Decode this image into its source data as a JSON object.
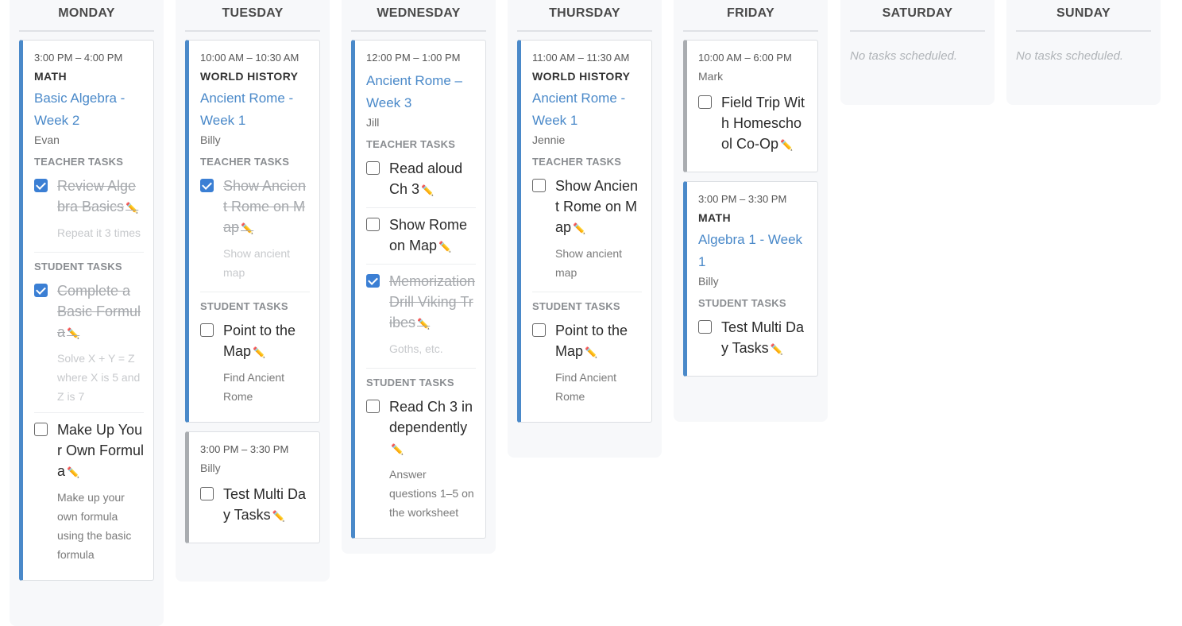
{
  "days": [
    {
      "name": "MONDAY"
    },
    {
      "name": "TUESDAY"
    },
    {
      "name": "WEDNESDAY"
    },
    {
      "name": "THURSDAY"
    },
    {
      "name": "FRIDAY"
    },
    {
      "name": "SATURDAY"
    },
    {
      "name": "SUNDAY"
    }
  ],
  "labels": {
    "teacher_tasks": "TEACHER TASKS",
    "student_tasks": "STUDENT TASKS",
    "no_tasks": "No tasks scheduled.",
    "edit_icon": "pencil-icon"
  },
  "monday": {
    "card1": {
      "time": "3:00 PM – 4:00 PM",
      "subject": "MATH",
      "lesson": "Basic Algebra - Week 2",
      "person": "Evan",
      "teacher_tasks": [
        {
          "title": "Review Algebra Basics",
          "note": "Repeat it 3 times",
          "done": true
        }
      ],
      "student_tasks": [
        {
          "title": "Complete a Basic Formula",
          "note": "Solve X + Y = Z where X is 5 and Z is 7",
          "done": true
        },
        {
          "title": "Make Up Your Own Formula",
          "note": "Make up your own formula using the basic formula",
          "done": false
        }
      ]
    }
  },
  "tuesday": {
    "card1": {
      "time": "10:00 AM – 10:30 AM",
      "subject": "WORLD HISTORY",
      "lesson": "Ancient Rome - Week 1",
      "person": "Billy",
      "teacher_tasks": [
        {
          "title": "Show Ancient Rome on Map",
          "note": "Show ancient map",
          "done": true
        }
      ],
      "student_tasks": [
        {
          "title": "Point to the Map",
          "note": "Find Ancient Rome",
          "done": false
        }
      ]
    },
    "card2": {
      "time": "3:00 PM – 3:30 PM",
      "person": "Billy",
      "tasks": [
        {
          "title": "Test Multi Day Tasks",
          "done": false
        }
      ]
    }
  },
  "wednesday": {
    "card1": {
      "time": "12:00 PM – 1:00 PM",
      "lesson": "Ancient Rome – Week 3",
      "person": "Jill",
      "teacher_tasks": [
        {
          "title": "Read aloud Ch 3",
          "done": false
        },
        {
          "title": "Show Rome on Map",
          "done": false
        },
        {
          "title": "Memorization Drill Viking Tribes",
          "note": "Goths, etc.",
          "done": true
        }
      ],
      "student_tasks": [
        {
          "title": "Read Ch 3 independently",
          "note": "Answer questions 1–5 on the worksheet",
          "done": false
        }
      ]
    }
  },
  "thursday": {
    "card1": {
      "time": "11:00 AM – 11:30 AM",
      "subject": "WORLD HISTORY",
      "lesson": "Ancient Rome - Week 1",
      "person": "Jennie",
      "teacher_tasks": [
        {
          "title": "Show Ancient Rome on Map",
          "note": "Show ancient map",
          "done": false
        }
      ],
      "student_tasks": [
        {
          "title": "Point to the Map",
          "note": "Find Ancient Rome",
          "done": false
        }
      ]
    }
  },
  "friday": {
    "card1": {
      "time": "10:00 AM – 6:00 PM",
      "person": "Mark",
      "tasks": [
        {
          "title": "Field Trip With Homeschool Co-Op",
          "done": false
        }
      ]
    },
    "card2": {
      "time": "3:00 PM – 3:30 PM",
      "subject": "MATH",
      "lesson": "Algebra 1 - Week 1",
      "person": "Billy",
      "student_tasks": [
        {
          "title": "Test Multi Day Tasks",
          "done": false
        }
      ]
    }
  },
  "colors": {
    "accent_blue": "#4a89c9",
    "gray_bar": "#a9acb0",
    "checkbox_checked": "#3b7fd4",
    "edit_icon": "#c0392b"
  }
}
